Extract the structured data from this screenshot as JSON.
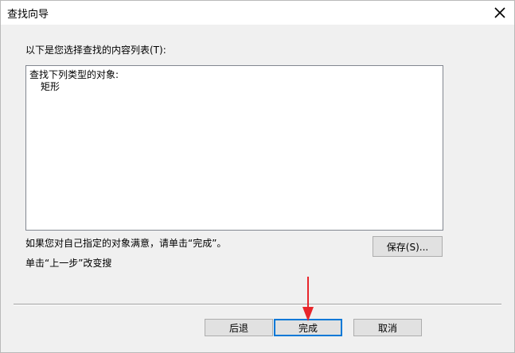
{
  "window": {
    "title": "查找向导"
  },
  "dialog": {
    "intro_label": "以下是您选择查找的内容列表(T):",
    "list": {
      "header": "查找下列类型的对象:",
      "items": [
        "矩形"
      ]
    },
    "hint_finish": "如果您对自己指定的对象满意，请单击“完成”。",
    "hint_back": "单击“上一步”改变搜",
    "save_button": "保存(S)...",
    "back_button": "后退",
    "finish_button": "完成",
    "cancel_button": "取消"
  },
  "colors": {
    "accent": "#0078d7",
    "annotation_arrow": "#e8262b"
  },
  "icons": {
    "close": "close-icon",
    "annotation": "arrow-annotation"
  }
}
